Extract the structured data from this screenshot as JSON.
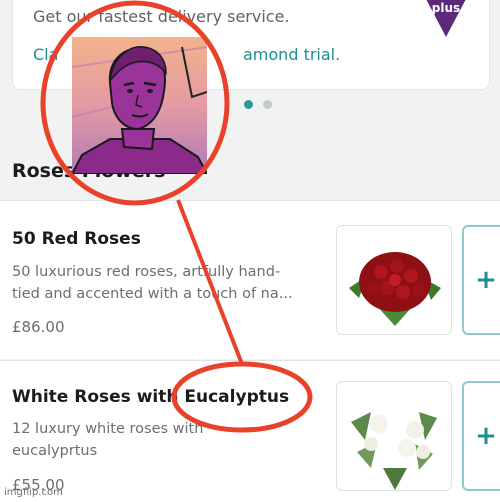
{
  "promo": {
    "line1": "Get our fastest delivery service.",
    "line2_left": "Cla",
    "line2_right": "amond trial.",
    "badge": "plus"
  },
  "carousel": {
    "active_index": 0,
    "count": 2
  },
  "section": {
    "title": "Roses Flowers"
  },
  "products": [
    {
      "name": "50 Red Roses",
      "desc_line1": "50 luxurious red roses, artfully hand-",
      "desc_line2": "tied and accented with a touch of na...",
      "price": "£86.00",
      "add": "+"
    },
    {
      "name": "White Roses with Eucalyptus",
      "desc_line1": "12 luxury white roses with",
      "desc_line2": "eucalyprtus",
      "price": "£55.00",
      "add": "+"
    }
  ],
  "overlay": {
    "annotation_color": "#e8432a"
  },
  "watermark": "imgflip.com",
  "colors": {
    "accent": "#1d8f90",
    "badge": "#5b2a7a",
    "portrait": "#8b2a8a"
  }
}
